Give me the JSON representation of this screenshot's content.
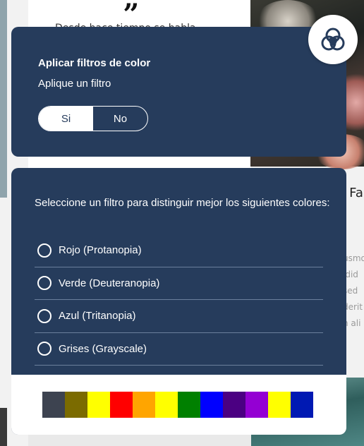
{
  "background": {
    "quote_mark": "„",
    "partial_line": "Desde hace tiempo se habla",
    "heading_fragment": "g Fa",
    "body_fragments": [
      "usmo",
      "idid",
      "sed",
      "derit",
      "n ali"
    ]
  },
  "widget": {
    "button_icon": "color-filters-icon",
    "toggle_panel": {
      "title": "Aplicar filtros de color",
      "subtitle": "Aplique un filtro",
      "options": [
        {
          "label": "Si",
          "selected": true
        },
        {
          "label": "No",
          "selected": false
        }
      ]
    },
    "filters_panel": {
      "intro": "Seleccione un filtro para distinguir mejor los siguientes colores:",
      "filters": [
        {
          "label": "Rojo (Protanopia)"
        },
        {
          "label": "Verde (Deuteranopia)"
        },
        {
          "label": "Azul (Tritanopia)"
        },
        {
          "label": "Grises (Grayscale)"
        }
      ],
      "swatches": [
        "#3d4350",
        "#7b6b00",
        "#ffff00",
        "#ff0000",
        "#ffa500",
        "#ffff00",
        "#008000",
        "#0000ff",
        "#4b0082",
        "#9400d3",
        "#ffff00",
        "#0019b3"
      ]
    },
    "colors": {
      "panel": "#263c5c",
      "divider": "#6b7f9c",
      "text": "#ffffff"
    }
  }
}
